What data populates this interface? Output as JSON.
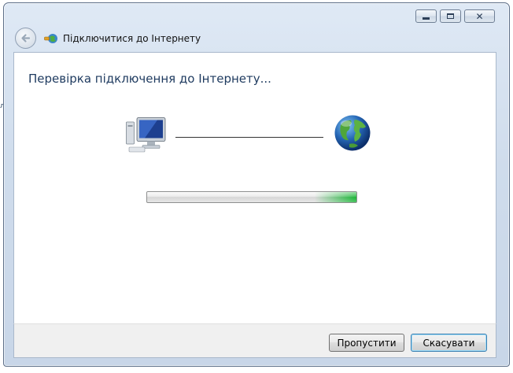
{
  "window": {
    "title": "Підключитися до Інтернету",
    "caption_buttons": [
      "minimize",
      "maximize",
      "close"
    ],
    "close_glyph": "✕"
  },
  "edge_text": "л",
  "content": {
    "heading": "Перевірка підключення до Інтернету...",
    "progress": {
      "value": 1.0,
      "style": "marquee-green"
    },
    "icons": [
      "computer-icon",
      "globe-icon"
    ]
  },
  "footer": {
    "skip_label": "Пропустити",
    "cancel_label": "Скасувати"
  },
  "colors": {
    "heading": "#1e3a5f",
    "chrome": "#cfdcec",
    "progress_green": "#06b025"
  }
}
